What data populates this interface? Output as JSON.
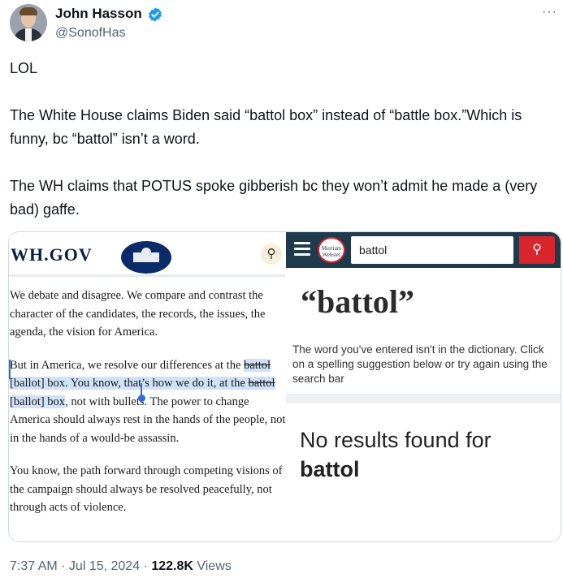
{
  "author": {
    "name": "John Hasson",
    "handle": "@SonofHas",
    "verified": true,
    "badge_color": "#1d9bf0"
  },
  "more_menu": "···",
  "tweet": {
    "line1": "LOL",
    "para2": "The White House claims Biden said “battol box” instead of “battle box.”Which is funny, bc “battol” isn’t a word.",
    "para3": "The WH claims that POTUS spoke gibberish bc they won’t admit he made a (very bad) gaffe."
  },
  "wh_screenshot": {
    "logo": "WH.GOV",
    "search_icon": "search-icon",
    "p1": "We debate and disagree.  We compare and contrast the character of the candidates, the records, the issues, the agenda, the vision for America.",
    "p2_a": "But in America, we resolve our differences at the ",
    "p2_strike1": "battol",
    "p2_b": " [ballot] box.  You know, that’s how we do it, at the ",
    "p2_strike2": "battol",
    "p2_c": " [ballot] box",
    "p2_d": ", not with bullets.  The power to change America should always rest in the hands of the people, not in the hands of a would-be assassin.",
    "p3": "You know, the path forward through competing visions of the campaign should always be resolved peacefully, not through acts of violence."
  },
  "mw_screenshot": {
    "logo": "Merriam Webster",
    "search_value": "battol",
    "search_icon": "search-icon",
    "headword": "“battol”",
    "message": "The word you've entered isn't in the dictionary. Click on a spelling suggestion below or try again using the search bar",
    "no_results": "No results found for",
    "no_results_term": "battol"
  },
  "meta": {
    "time": "7:37 AM",
    "sep1": " · ",
    "date": "Jul 15, 2024",
    "sep2": " · ",
    "views": "122.8K",
    "views_label": " Views"
  }
}
